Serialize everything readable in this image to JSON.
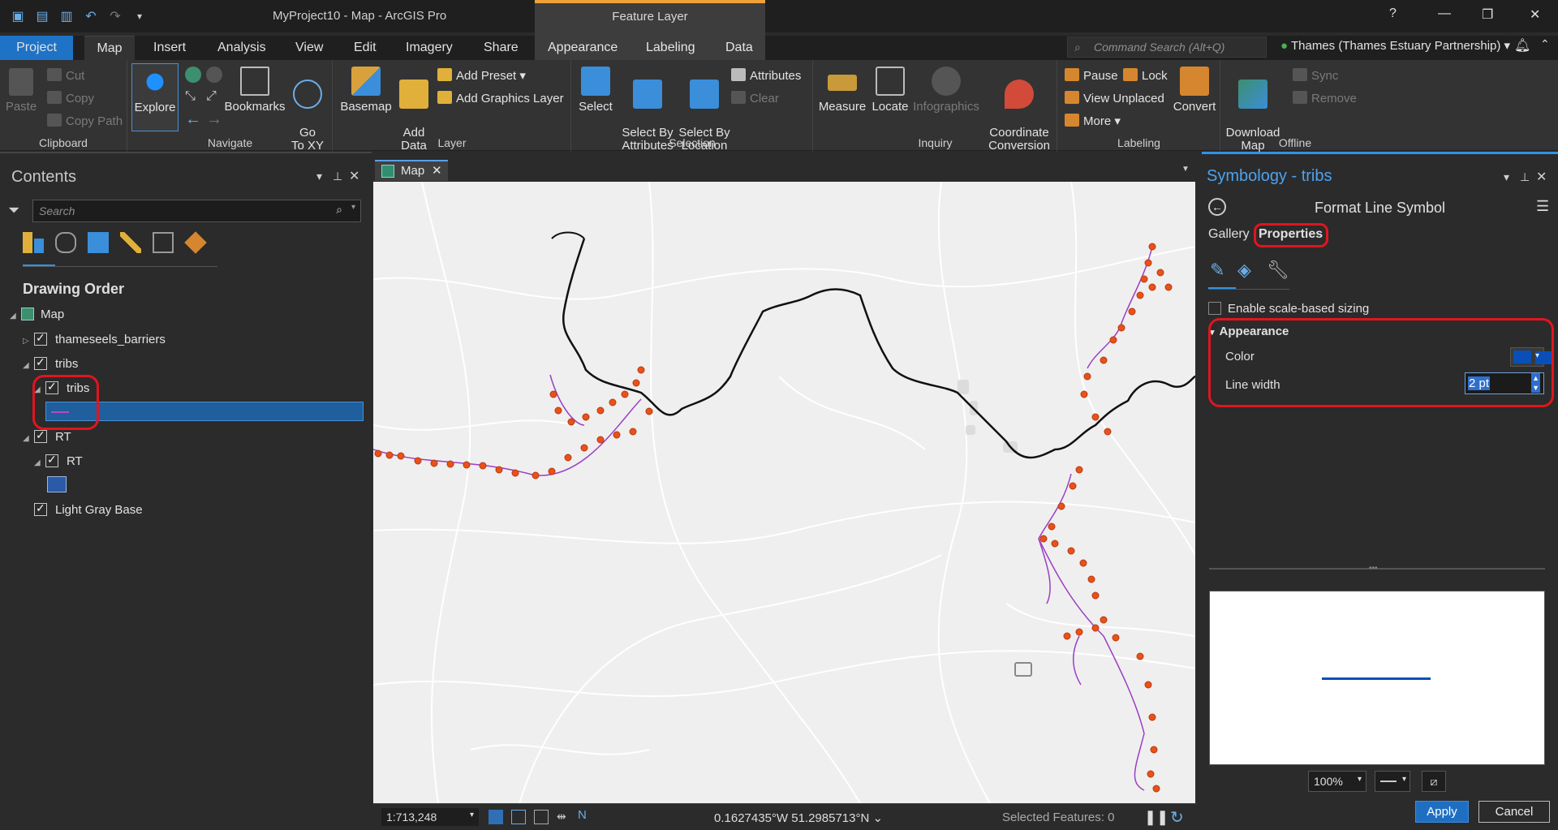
{
  "app": {
    "title": "MyProject10 - Map - ArcGIS Pro",
    "context_group": "Feature Layer"
  },
  "window": {
    "help": "?",
    "minimize": "—",
    "restore": "❐",
    "close": "✕"
  },
  "tabs": [
    "Project",
    "Map",
    "Insert",
    "Analysis",
    "View",
    "Edit",
    "Imagery",
    "Share",
    "Appearance",
    "Labeling",
    "Data"
  ],
  "command_search": {
    "placeholder": "Command Search (Alt+Q)"
  },
  "user": {
    "name": "Thames (Thames Estuary Partnership)"
  },
  "ribbon": {
    "clipboard": {
      "label": "Clipboard",
      "paste": "Paste",
      "cut": "Cut",
      "copy": "Copy",
      "copy_path": "Copy Path"
    },
    "navigate": {
      "label": "Navigate",
      "explore": "Explore",
      "bookmarks": "Bookmarks",
      "goto_xy": "Go\nTo XY"
    },
    "layer": {
      "label": "Layer",
      "basemap": "Basemap",
      "add_data": "Add\nData",
      "add_preset": "Add Preset",
      "add_graphics": "Add Graphics Layer"
    },
    "selection": {
      "label": "Selection",
      "select": "Select",
      "select_by_attr": "Select By\nAttributes",
      "select_by_loc": "Select By\nLocation",
      "attributes": "Attributes",
      "clear": "Clear"
    },
    "inquiry": {
      "label": "Inquiry",
      "measure": "Measure",
      "locate": "Locate",
      "infographics": "Infographics",
      "coord_conv": "Coordinate\nConversion"
    },
    "labeling": {
      "label": "Labeling",
      "pause": "Pause",
      "lock": "Lock",
      "view_unplaced": "View Unplaced",
      "more": "More",
      "convert": "Convert"
    },
    "offline": {
      "label": "Offline",
      "download": "Download\nMap",
      "sync": "Sync",
      "remove": "Remove"
    }
  },
  "contents": {
    "title": "Contents",
    "search_placeholder": "Search",
    "section": "Drawing Order",
    "items": {
      "map": "Map",
      "barriers": "thameseels_barriers",
      "tribs_group": "tribs",
      "tribs_layer": "tribs",
      "rt_group": "RT",
      "rt_layer": "RT",
      "basemap": "Light Gray Base"
    }
  },
  "mapview": {
    "tab": "Map",
    "scale": "1:713,248",
    "coords": "0.1627435°W 51.2985713°N",
    "selected": "Selected Features: 0"
  },
  "symbology": {
    "title": "Symbology - tribs",
    "heading": "Format Line Symbol",
    "tabs": {
      "gallery": "Gallery",
      "properties": "Properties"
    },
    "scale_based": "Enable scale-based sizing",
    "appearance": "Appearance",
    "color_label": "Color",
    "color_value": "#0a4fb8",
    "line_width_label": "Line width",
    "line_width_value": "2 pt",
    "zoom": "100%",
    "apply": "Apply",
    "cancel": "Cancel"
  },
  "colors": {
    "accent": "#2f93e8",
    "project_tab": "#1e73c6",
    "context_tab": "#f0a23a",
    "annotation": "#e0151f",
    "river": "#111111",
    "tribs": "#9b3fc4",
    "barrier_points": "#e8521a"
  }
}
